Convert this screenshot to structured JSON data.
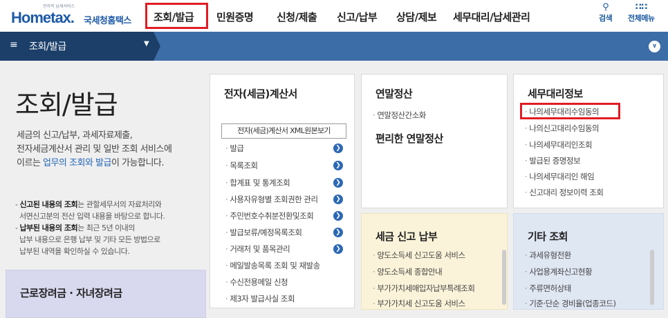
{
  "header": {
    "logo_small": "전자적 납세서비스",
    "logo_text": "Hometax.",
    "logo_kr": "국세청홈택스",
    "nav": [
      "조회/발급",
      "민원증명",
      "신청/제출",
      "신고/납부",
      "상담/제보",
      "세무대리/납세관리"
    ],
    "search_label": "검색",
    "allmenu_label": "전체메뉴"
  },
  "bar": {
    "label": "조회/발급"
  },
  "left": {
    "title": "조회/발급",
    "desc1": "세금의 신고/납부, 과세자료제출,",
    "desc2": "전자세금계산서 관리 및 일반 조회 서비스에",
    "desc3a": "이르는 ",
    "desc3b": "업무의 조회와 발급",
    "desc3c": "이 가능합니다.",
    "note1_bold": "신고된 내용의 조회",
    "note1_rest": "는 관할세무서의 자료처리와",
    "note1_line2": "서면신고분의 전산 입력 내용을 바탕으로 합니다.",
    "note2_bold": "납부된 내용의 조회",
    "note2_rest": "는 최근 5년 이내의",
    "note2_line2": "납부 내용으로 은행 납부 및 기타 모든 방법으로",
    "note2_line3": "납부된 내역을 확인하실 수 있습니다.",
    "child_title": "근로장려금 · 자녀장려금"
  },
  "card_invoice": {
    "title": "전자(세금)계산서",
    "button": "전자(세금)계산서 XML원본보기",
    "items": [
      "발급",
      "목록조회",
      "합계표 및 통계조회",
      "사용자유형별 조회권한 관리",
      "주민번호수취분전환및조회",
      "발급보류/예정목록조회",
      "거래처 및 품목관리",
      "메일발송목록 조회 및 재발송",
      "수신전용메일 신청",
      "제3자 발급사실 조회"
    ]
  },
  "card_yearend": {
    "title": "연말정산",
    "items": [
      "연말정산간소화"
    ],
    "subtitle": "편리한 연말정산"
  },
  "card_agent": {
    "title": "세무대리정보",
    "items": [
      "나의세무대리수임동의",
      "나의신고대리수임동의",
      "나의세무대리인조회",
      "발급된 증명정보",
      "나의세무대리인 해임",
      "신고대리 정보이력 조회"
    ]
  },
  "card_tax": {
    "title": "세금 신고 납부",
    "items": [
      "양도소득세 신고도움 서비스",
      "양도소득세 종합안내",
      "부가가치세매입자납부특례조회",
      "부가가치세 신고도움 서비스"
    ]
  },
  "card_etc": {
    "title": "기타 조회",
    "items": [
      "과세유형전환",
      "사업용계좌신고현황",
      "주류면허상태",
      "기준·단순 경비율(업종코드)"
    ]
  }
}
